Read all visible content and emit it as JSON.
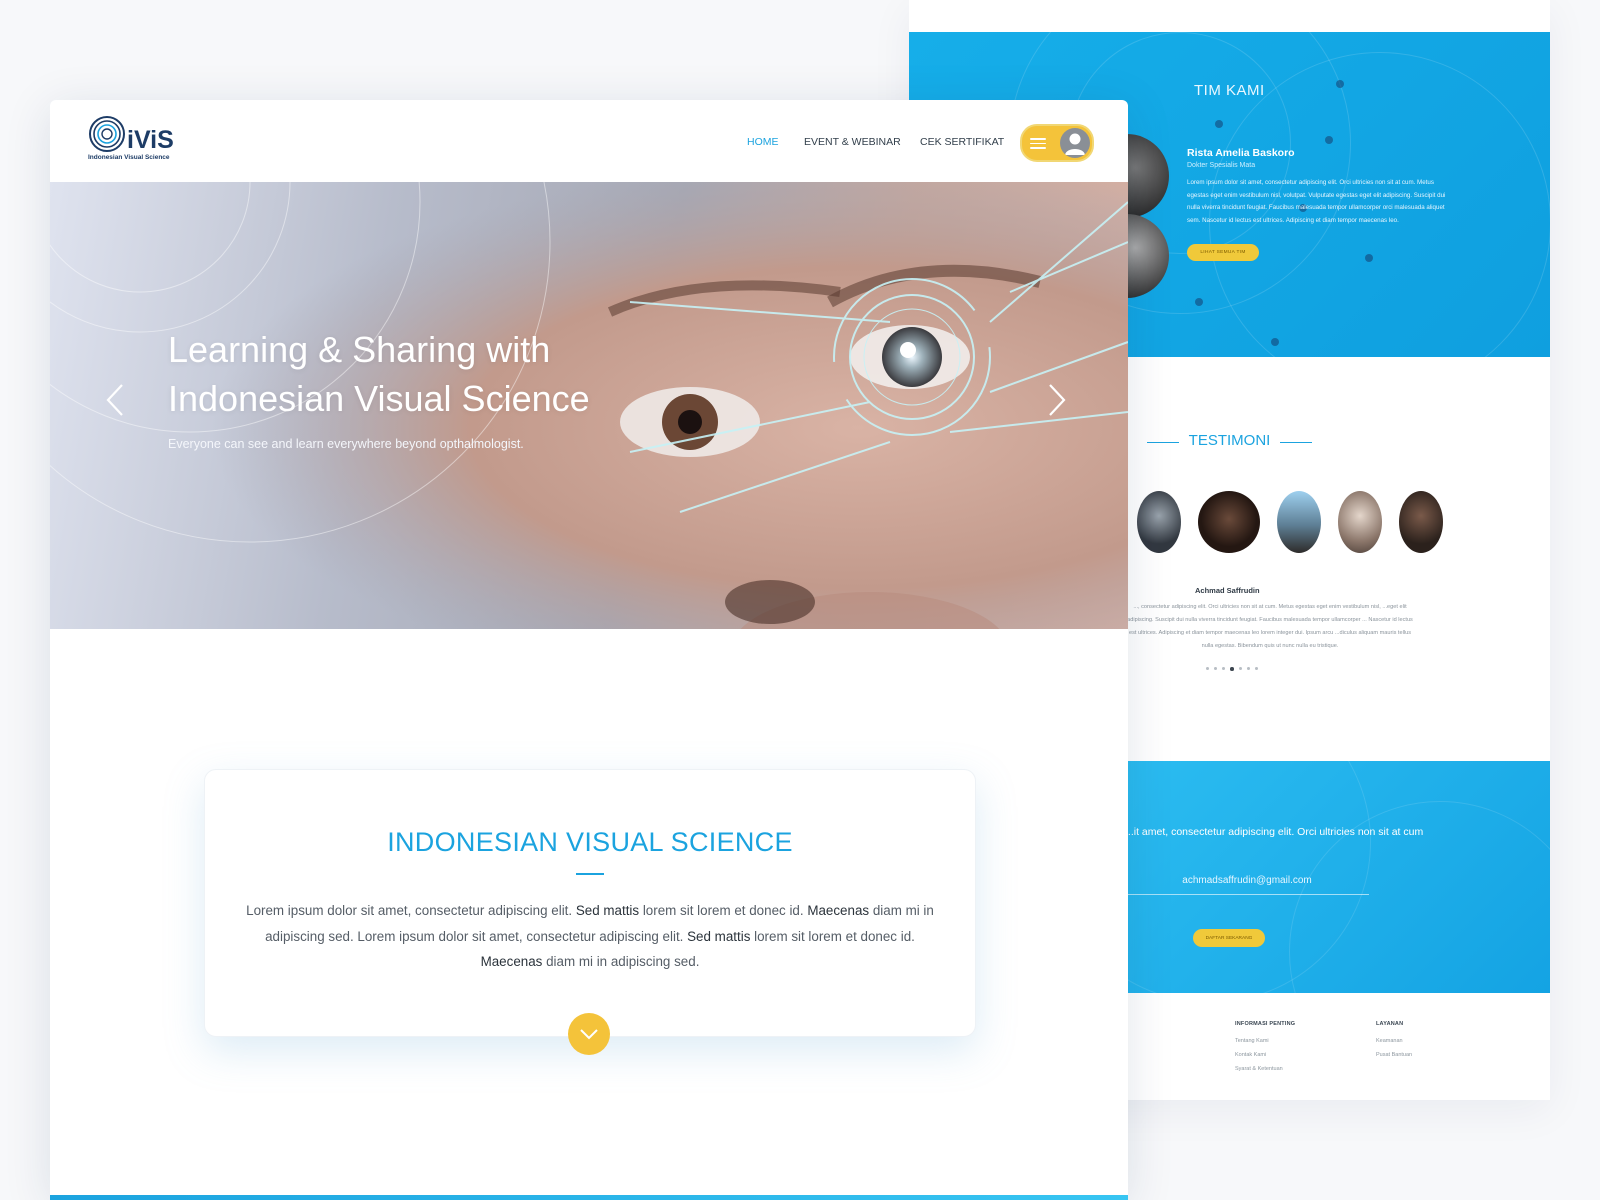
{
  "back": {
    "team": {
      "title": "TIM KAMI",
      "member_name": "Rista Amelia Baskoro",
      "member_role": "Dokter Spesialis Mata",
      "member_bio": "Lorem ipsum dolor sit amet, consectetur adipiscing elit. Orci ultricies non sit at cum. Metus egestas eget enim vestibulum nisl, volutpat. Vulputate egestas eget elit adipiscing. Suscipit dui nulla viverra tincidunt feugiat. Faucibus malesuada tempor ullamcorper orci malesuada aliquet sem. Nascetur id lectus est ultrices. Adipiscing et diam tempor maecenas leo.",
      "button_label": "LIHAT SEMUA TIM"
    },
    "testimoni": {
      "title": "TESTIMONI",
      "name": "Achmad Saffrudin",
      "text": "..., consectetur adipiscing elit. Orci ultricies non sit at cum. Metus egestas eget enim vestibulum nisl, ...eget elit adipiscing. Suscipit dui nulla viverra tincidunt feugiat. Faucibus malesuada tempor ullamcorper ... Nascetur id lectus est ultrices. Adipiscing et diam tempor maecenas leo lorem integer dui. Ipsum arcu ...diculus aliquam mauris tellus nulla egestas. Bibendum quis ut nunc nulla eu tristique.",
      "active_slide": 4,
      "slide_count": 7
    },
    "newsletter": {
      "text": "...it amet, consectetur adipiscing elit. Orci ultricies non sit at cum",
      "email": "achmadsaffrudin@gmail.com",
      "button_label": "DAFTAR SEKARANG"
    },
    "footer": {
      "col1": {
        "heading": "INFORMASI PENTING",
        "links": [
          "Tentang Kami",
          "Kontak Kami",
          "Syarat & Ketentuan"
        ]
      },
      "col2": {
        "heading": "LAYANAN",
        "links": [
          "Keamanan",
          "Pusat Bantuan"
        ]
      }
    }
  },
  "front": {
    "logo": {
      "first": "O",
      "rest": "iViS",
      "sub": "Indonesian Visual Science"
    },
    "nav": {
      "home": "HOME",
      "event": "EVENT & WEBINAR",
      "cert": "CEK SERTIFIKAT"
    },
    "hero": {
      "title_line1": "Learning & Sharing with",
      "title_line2": "Indonesian Visual Science",
      "subtitle": "Everyone can see and learn everywhere beyond opthalmologist."
    },
    "about": {
      "title": "INDONESIAN VISUAL SCIENCE",
      "p1": "Lorem ipsum dolor sit amet, consectetur adipiscing elit. ",
      "b1": "Sed mattis",
      "p2": " lorem sit lorem et donec id. ",
      "b2": "Maecenas",
      "p3": " diam mi in adipiscing sed. Lorem ipsum dolor sit amet, consectetur adipiscing elit. ",
      "b3": "Sed mattis",
      "p4": " lorem sit lorem et donec id. ",
      "b4": "Maecenas",
      "p5": " diam mi in adipiscing sed."
    }
  },
  "colors": {
    "primary": "#1ba3df",
    "accent": "#f4c33a",
    "text_dark": "#33404c",
    "navy": "#1d3c66"
  }
}
